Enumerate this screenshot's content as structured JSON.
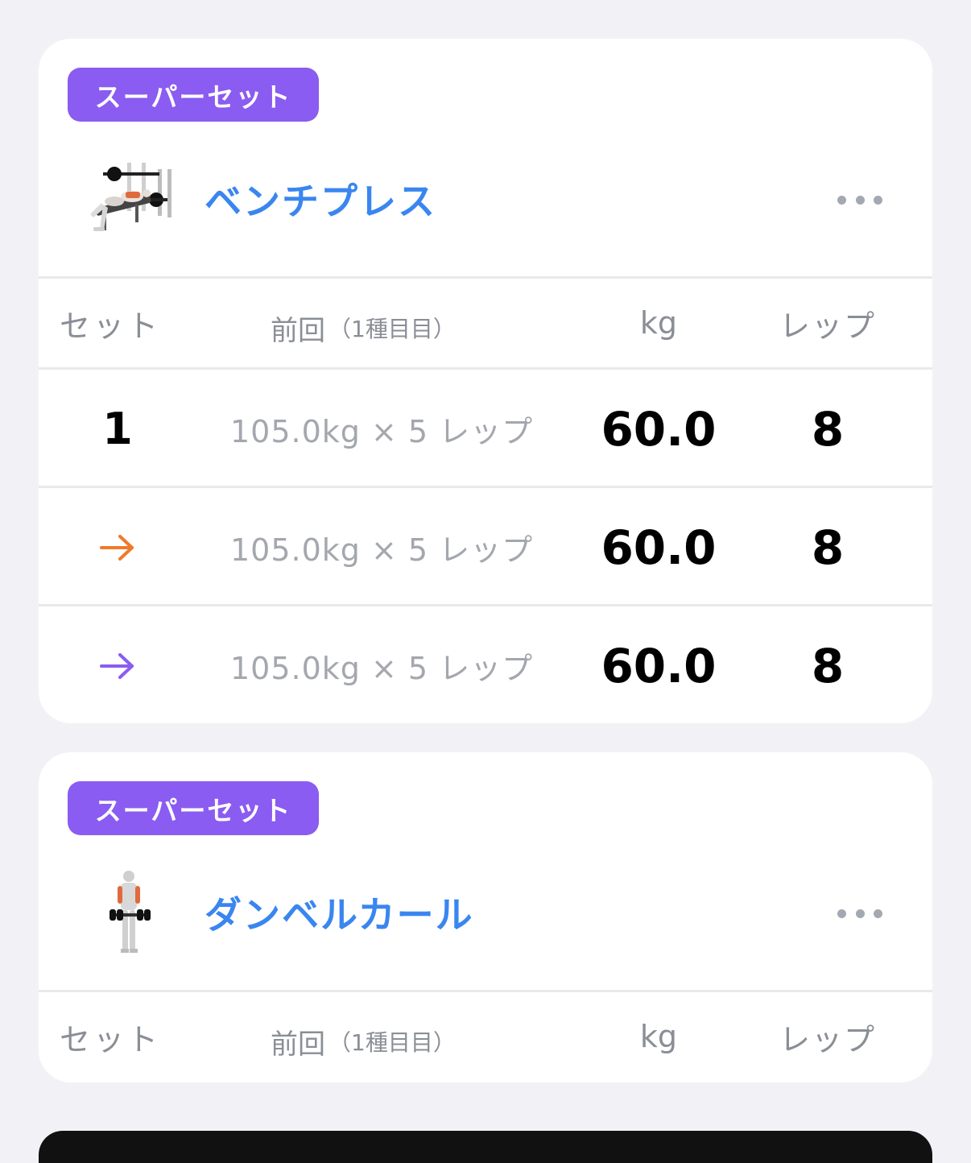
{
  "exercises": [
    {
      "badge": "スーパーセット",
      "name": "ベンチプレス",
      "thumb_icon": "bench-press-illustration",
      "headers": {
        "set": "セット",
        "prev": "前回",
        "prev_note": "（1種目目）",
        "kg": "kg",
        "reps": "レップ"
      },
      "rows": [
        {
          "set": "1",
          "set_type": "number",
          "prev": "105.0kg × 5 レップ",
          "kg": "60.0",
          "reps": "8"
        },
        {
          "set": "→",
          "set_type": "arrow",
          "arrow_color": "#f07a2a",
          "prev": "105.0kg × 5 レップ",
          "kg": "60.0",
          "reps": "8"
        },
        {
          "set": "→",
          "set_type": "arrow",
          "arrow_color": "#8a5cf1",
          "prev": "105.0kg × 5 レップ",
          "kg": "60.0",
          "reps": "8"
        }
      ]
    },
    {
      "badge": "スーパーセット",
      "name": "ダンベルカール",
      "thumb_icon": "dumbbell-curl-illustration",
      "headers": {
        "set": "セット",
        "prev": "前回",
        "prev_note": "（1種目目）",
        "kg": "kg",
        "reps": "レップ"
      }
    }
  ],
  "colors": {
    "accent_purple": "#8a5cf1",
    "title_blue": "#3a86f0",
    "arrow_orange": "#f07a2a"
  }
}
